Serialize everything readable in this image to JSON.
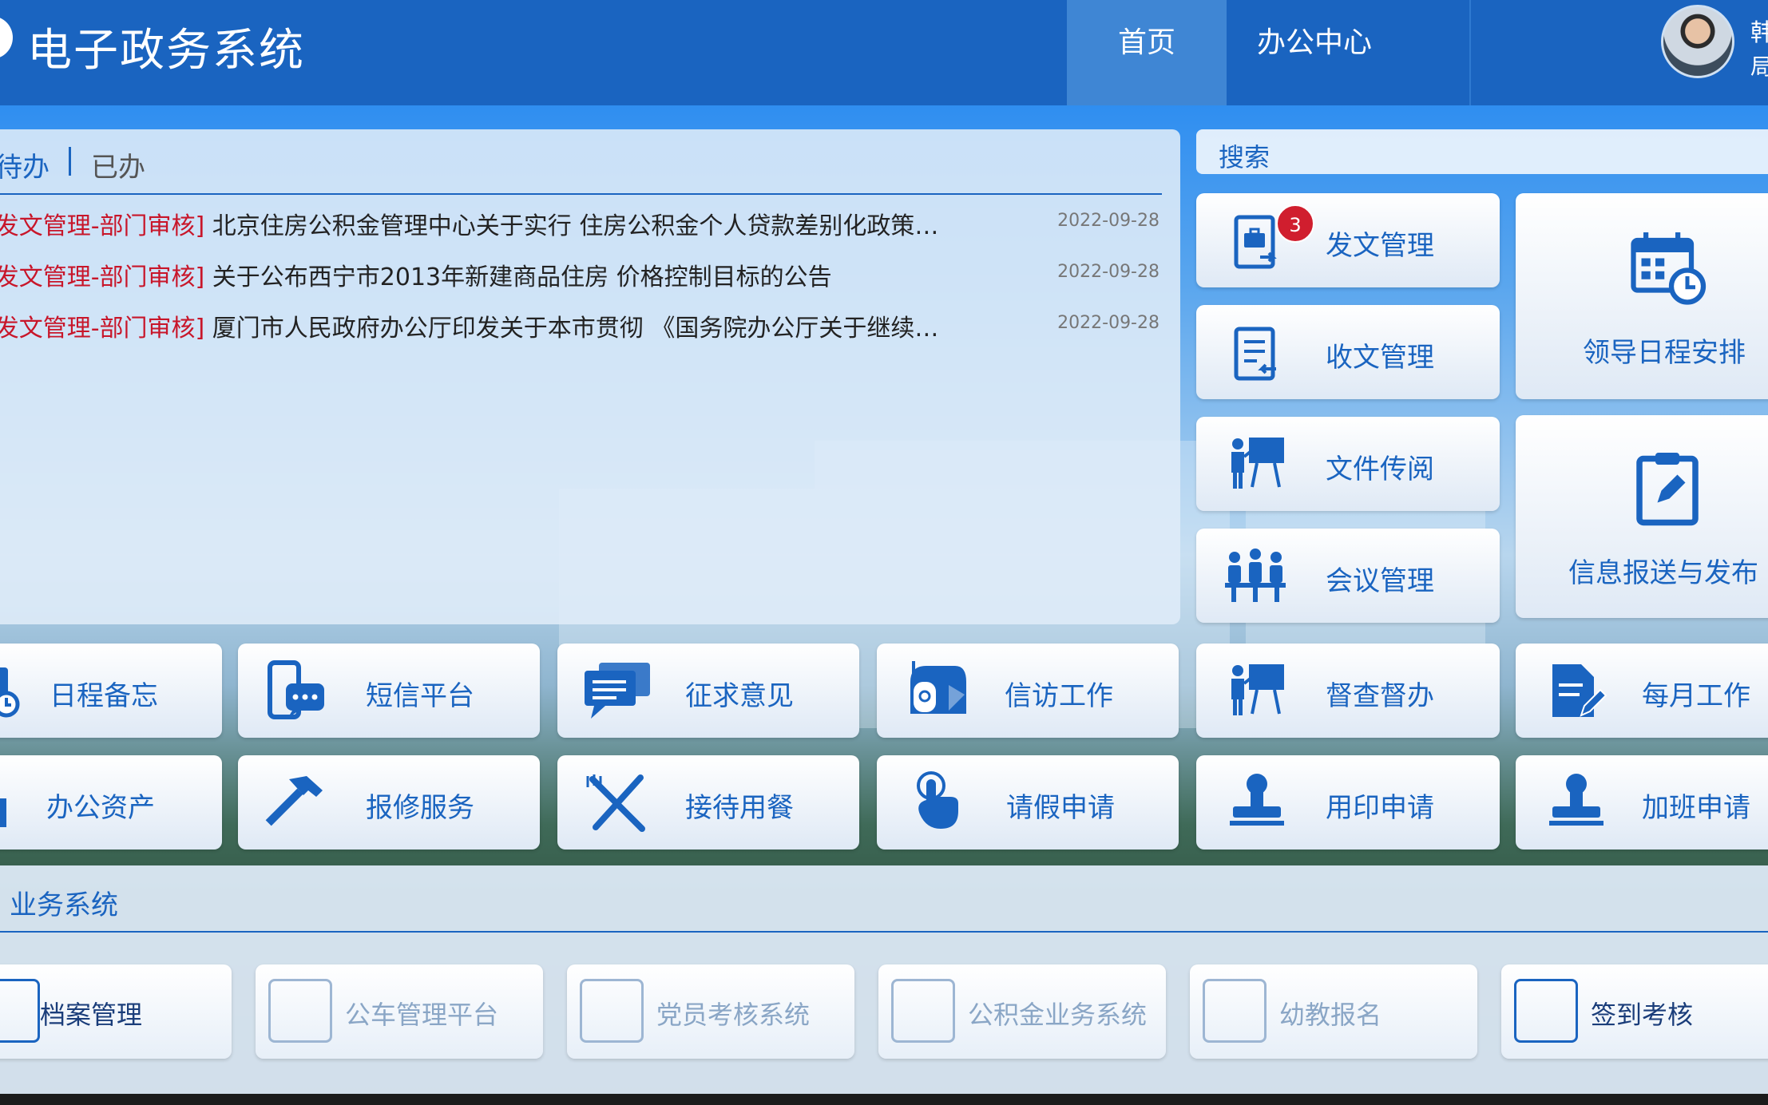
{
  "header": {
    "title": "电子政务系统",
    "nav": [
      "首页",
      "办公中心"
    ],
    "user": {
      "name": "韩",
      "role": "局"
    }
  },
  "todo": {
    "tabs": {
      "pending": "待办",
      "done": "已办"
    },
    "rows": [
      {
        "category": "[发文管理-部门审核]",
        "text": "北京住房公积金管理中心关于实行 住房公积金个人贷款差别化政策…",
        "date": "2022-09-28"
      },
      {
        "category": "[发文管理-部门审核]",
        "text": "关于公布西宁市2013年新建商品住房 价格控制目标的公告",
        "date": "2022-09-28"
      },
      {
        "category": "[发文管理-部门审核]",
        "text": "厦门市人民政府办公厅印发关于本市贯彻 《国务院办公厅关于继续…",
        "date": "2022-09-28"
      }
    ]
  },
  "search": {
    "label": "搜索"
  },
  "right_tiles": {
    "fawen": {
      "label": "发文管理",
      "badge": "3",
      "icon": "document-briefcase-icon"
    },
    "shouwen": {
      "label": "收文管理",
      "icon": "document-receive-icon"
    },
    "chuanyue": {
      "label": "文件传阅",
      "icon": "presentation-icon"
    },
    "huiyi": {
      "label": "会议管理",
      "icon": "meeting-icon"
    },
    "richeng": {
      "label": "领导日程安排",
      "icon": "calendar-clock-icon"
    },
    "xinxi": {
      "label": "信息报送与发布",
      "icon": "clipboard-edit-icon"
    }
  },
  "grid_tiles": {
    "row1": [
      {
        "label": "日程备忘",
        "icon": "memo-icon"
      },
      {
        "label": "短信平台",
        "icon": "phone-message-icon"
      },
      {
        "label": "征求意见",
        "icon": "chat-icon"
      },
      {
        "label": "信访工作",
        "icon": "mailbox-icon"
      },
      {
        "label": "督查督办",
        "icon": "presentation-icon"
      },
      {
        "label": "每月工作",
        "icon": "document-edit-icon"
      }
    ],
    "row2": [
      {
        "label": "办公资产",
        "icon": "asset-icon"
      },
      {
        "label": "报修服务",
        "icon": "hammer-icon"
      },
      {
        "label": "接待用餐",
        "icon": "fork-knife-icon"
      },
      {
        "label": "请假申请",
        "icon": "hand-pointer-icon"
      },
      {
        "label": "用印申请",
        "icon": "stamp-icon"
      },
      {
        "label": "加班申请",
        "icon": "stamp-icon"
      }
    ]
  },
  "business": {
    "title": "业务系统",
    "items": [
      {
        "label": "档案管理",
        "active": true,
        "icon": "archive-icon"
      },
      {
        "label": "公车管理平台",
        "active": false,
        "icon": "car-icon"
      },
      {
        "label": "党员考核系统",
        "active": false,
        "icon": "person-icon"
      },
      {
        "label": "公积金业务系统",
        "active": false,
        "icon": "house-icon"
      },
      {
        "label": "幼教报名",
        "active": false,
        "icon": "board-icon"
      },
      {
        "label": "签到考核",
        "active": true,
        "icon": "calendar-check-icon"
      }
    ]
  }
}
